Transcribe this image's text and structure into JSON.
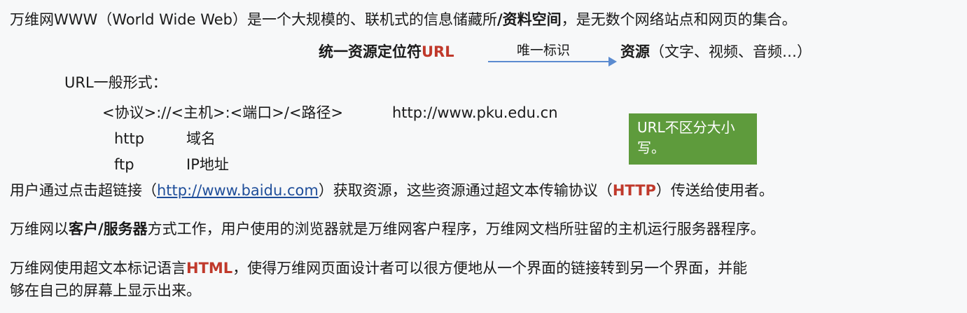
{
  "line1": {
    "text_a": "万维网WWW（World Wide Web）是一个大规模的、联机式的信息储藏所",
    "text_b": "/资料空间",
    "text_c": "，是无数个网络站点和网页的集合。"
  },
  "url_line": {
    "prefix": "统一资源定位符",
    "url": "URL",
    "arrow_label": "唯一标识",
    "resource": "资源",
    "resource_examples": "（文字、视频、音频…）"
  },
  "url_format": {
    "heading": "URL一般形式：",
    "pattern": "<协议>://<主机>:<端口>/<路径>",
    "example": "http://www.pku.edu.cn",
    "rows": [
      {
        "protocol": "http",
        "host": "域名"
      },
      {
        "protocol": "ftp",
        "host": "IP地址"
      }
    ]
  },
  "note": {
    "text": "URL不区分大小写。",
    "color": "#5e9b3c"
  },
  "para_link": {
    "a": "用户通过点击超链接（",
    "link": "http://www.baidu.com",
    "b": "）获取资源，这些资源通过超文本传输协议（",
    "http": "HTTP",
    "c": "）传送给使用者。"
  },
  "para_cs": {
    "a": "万维网以",
    "bold": "客户/服务器",
    "b": "方式工作，用户使用的浏览器就是万维网客户程序，万维网文档所驻留的主机运行服务器程序。"
  },
  "para_html": {
    "a": "万维网使用超文本标记语言",
    "html": "HTML",
    "b": "，使得万维网页面设计者可以很方便地从一个界面的链接转到另一个界面，并能",
    "c": "够在自己的屏幕上显示出来。"
  },
  "colors": {
    "accent_red": "#c0392b",
    "link_blue": "#1f4e9a",
    "arrow_blue": "#5b8bd0"
  }
}
